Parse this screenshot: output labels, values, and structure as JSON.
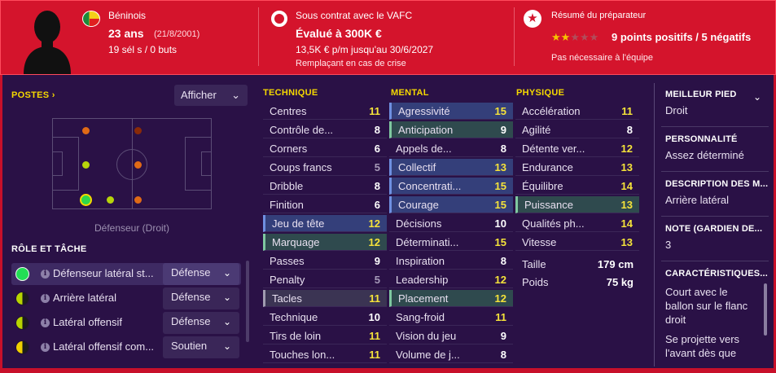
{
  "header": {
    "nationality": "Béninois",
    "age": "23 ans",
    "dob": "(21/8/2001)",
    "caps": "19 sél s / 0 buts",
    "contract_line": "Sous contrat avec le VAFC",
    "value": "Évalué à 300K €",
    "wage": "13,5K € p/m jusqu'au 30/6/2027",
    "squad_status": "Remplaçant en cas de crise",
    "coach_summary_title": "Résumé du préparateur",
    "coach_points": "9 points positifs / 5 négatifs",
    "coach_note": "Pas nécessaire à l'équipe",
    "star_rating": 2,
    "star_max": 5,
    "colors": {
      "header_bg": "#d4142c",
      "stars_on": "#f5c400"
    }
  },
  "positions": {
    "heading": "POSTES",
    "heading_icon": "chevron-right-icon",
    "show_button": "Afficher",
    "caption": "Défenseur (Droit)"
  },
  "roles": {
    "heading": "RÔLE ET TÂCHE",
    "items": [
      {
        "name": "Défenseur latéral st...",
        "duty": "Défense",
        "icon_color": "#22dd55"
      },
      {
        "name": "Arrière latéral",
        "duty": "Défense",
        "icon_color": "#b8d400"
      },
      {
        "name": "Latéral offensif",
        "duty": "Défense",
        "icon_color": "#b8d400"
      },
      {
        "name": "Latéral offensif com...",
        "duty": "Soutien",
        "icon_color": "#f0d000"
      }
    ]
  },
  "technique": {
    "heading": "TECHNIQUE",
    "rows": [
      {
        "name": "Centres",
        "value": "11"
      },
      {
        "name": "Contrôle de...",
        "value": "8"
      },
      {
        "name": "Corners",
        "value": "6"
      },
      {
        "name": "Coups francs",
        "value": "5"
      },
      {
        "name": "Dribble",
        "value": "8"
      },
      {
        "name": "Finition",
        "value": "6"
      },
      {
        "name": "Jeu de tête",
        "value": "12"
      },
      {
        "name": "Marquage",
        "value": "12"
      },
      {
        "name": "Passes",
        "value": "9"
      },
      {
        "name": "Penalty",
        "value": "5"
      },
      {
        "name": "Tacles",
        "value": "11"
      },
      {
        "name": "Technique",
        "value": "10"
      },
      {
        "name": "Tirs de loin",
        "value": "11"
      },
      {
        "name": "Touches lon...",
        "value": "11"
      }
    ]
  },
  "mental": {
    "heading": "MENTAL",
    "rows": [
      {
        "name": "Agressivité",
        "value": "15"
      },
      {
        "name": "Anticipation",
        "value": "9"
      },
      {
        "name": "Appels de...",
        "value": "8"
      },
      {
        "name": "Collectif",
        "value": "13"
      },
      {
        "name": "Concentrati...",
        "value": "15"
      },
      {
        "name": "Courage",
        "value": "15"
      },
      {
        "name": "Décisions",
        "value": "10"
      },
      {
        "name": "Déterminati...",
        "value": "15"
      },
      {
        "name": "Inspiration",
        "value": "8"
      },
      {
        "name": "Leadership",
        "value": "12"
      },
      {
        "name": "Placement",
        "value": "12"
      },
      {
        "name": "Sang-froid",
        "value": "11"
      },
      {
        "name": "Vision du jeu",
        "value": "9"
      },
      {
        "name": "Volume de j...",
        "value": "8"
      }
    ]
  },
  "physique": {
    "heading": "PHYSIQUE",
    "rows": [
      {
        "name": "Accélération",
        "value": "11"
      },
      {
        "name": "Agilité",
        "value": "8"
      },
      {
        "name": "Détente ver...",
        "value": "12"
      },
      {
        "name": "Endurance",
        "value": "13"
      },
      {
        "name": "Équilibre",
        "value": "14"
      },
      {
        "name": "Puissance",
        "value": "13"
      },
      {
        "name": "Qualités ph...",
        "value": "14"
      },
      {
        "name": "Vitesse",
        "value": "13"
      }
    ],
    "height_label": "Taille",
    "height_value": "179 cm",
    "weight_label": "Poids",
    "weight_value": "75 kg"
  },
  "sidebar": {
    "best_foot_title": "MEILLEUR PIED",
    "best_foot_value": "Droit",
    "personality_title": "PERSONNALITÉ",
    "personality_value": "Assez déterminé",
    "description_title": "DESCRIPTION DES M...",
    "description_value": "Arrière latéral",
    "rating_title": "NOTE (GARDIEN DE...",
    "rating_value": "3",
    "traits_title": "CARACTÉRISTIQUES...",
    "trait_1": "Court avec le ballon sur le flanc droit",
    "trait_2": "Se projette vers l'avant dès que"
  }
}
